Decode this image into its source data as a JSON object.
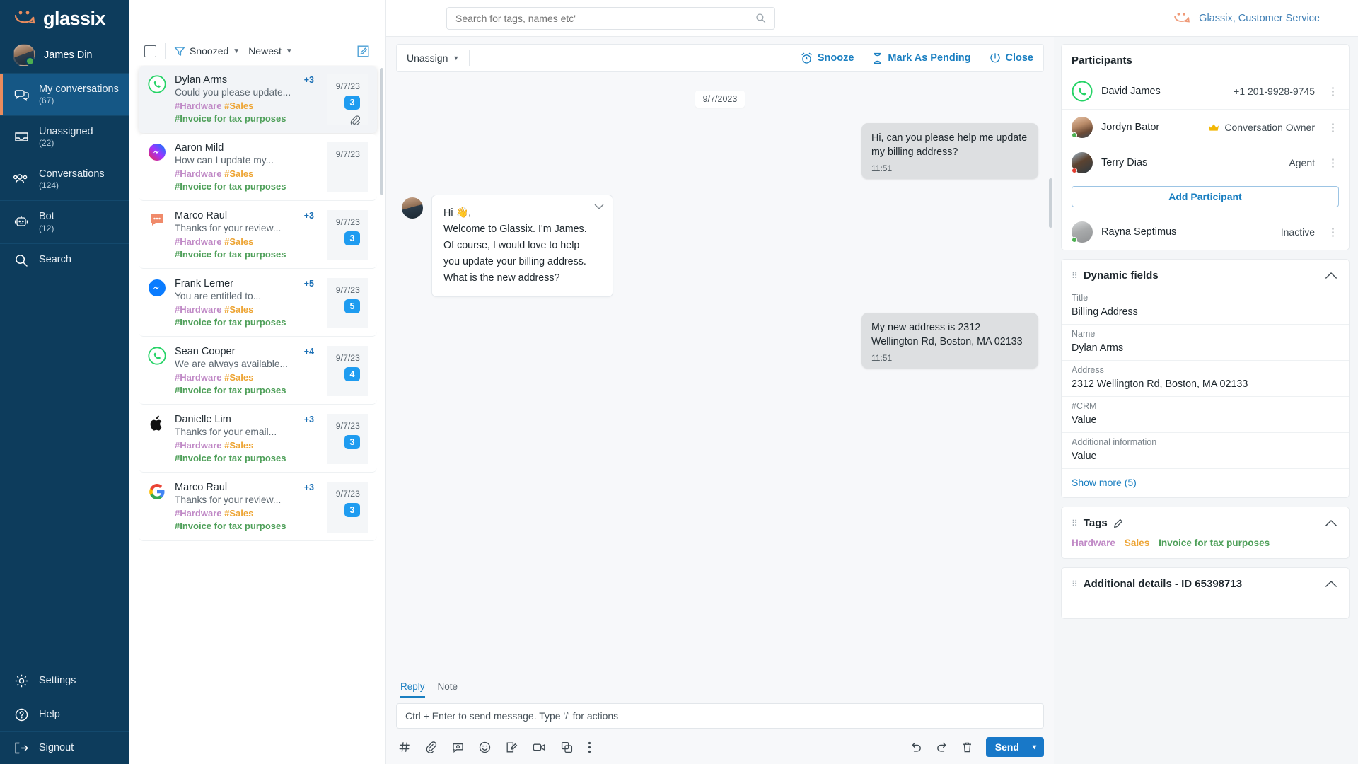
{
  "brand": {
    "name": "glassix",
    "accent": "#e98c5e",
    "nav_bg": "#0d3c5c",
    "active_bg": "#155785",
    "link_blue": "#1a7fc1"
  },
  "topbar": {
    "search_placeholder": "Search for tags, names etc'",
    "account_label": "Glassix, Customer Service"
  },
  "nav": {
    "user_name": "James Din",
    "items": [
      {
        "label": "My conversations",
        "count": "(67)",
        "icon": "conversations-icon",
        "active": true
      },
      {
        "label": "Unassigned",
        "count": "(22)",
        "icon": "inbox-icon",
        "active": false
      },
      {
        "label": "Conversations",
        "count": "(124)",
        "icon": "people-icon",
        "active": false
      },
      {
        "label": "Bot",
        "count": "(12)",
        "icon": "robot-icon",
        "active": false
      },
      {
        "label": "Search",
        "count": "",
        "icon": "search-icon",
        "active": false
      }
    ],
    "bottom_items": [
      {
        "label": "Settings",
        "icon": "gear-icon"
      },
      {
        "label": "Help",
        "icon": "question-circle-icon"
      },
      {
        "label": "Signout",
        "icon": "signout-icon"
      }
    ]
  },
  "list_toolbar": {
    "filter_label": "Snoozed",
    "sort_label": "Newest",
    "filter_icon": "funnel-icon",
    "compose_icon": "compose-icon",
    "select_all_icon": "checkbox-icon"
  },
  "conversations": [
    {
      "name": "Dylan Arms",
      "snippet": "Could you please update...",
      "plus": "+3",
      "date": "9/7/23",
      "badge": "3",
      "channel": "whatsapp-icon",
      "selected": true,
      "attachment": true,
      "tags": [
        "#Hardware",
        "#Sales",
        "#Invoice for tax purposes"
      ]
    },
    {
      "name": "Aaron Mild",
      "snippet": "How can I update my...",
      "plus": "",
      "date": "9/7/23",
      "badge": "",
      "channel": "messenger-icon",
      "selected": false,
      "attachment": false,
      "tags": [
        "#Hardware",
        "#Sales",
        "#Invoice for tax purposes"
      ]
    },
    {
      "name": "Marco Raul",
      "snippet": "Thanks for your review...",
      "plus": "+3",
      "date": "9/7/23",
      "badge": "3",
      "channel": "sms-icon",
      "selected": false,
      "attachment": false,
      "tags": [
        "#Hardware",
        "#Sales",
        "#Invoice for tax purposes"
      ]
    },
    {
      "name": "Frank Lerner",
      "snippet": "You are entitled to...",
      "plus": "+5",
      "date": "9/7/23",
      "badge": "5",
      "channel": "messenger-icon",
      "selected": false,
      "attachment": false,
      "tags": [
        "#Hardware",
        "#Sales",
        "#Invoice for tax purposes"
      ]
    },
    {
      "name": "Sean Cooper",
      "snippet": "We are always available...",
      "plus": "+4",
      "date": "9/7/23",
      "badge": "4",
      "channel": "whatsapp-icon",
      "selected": false,
      "attachment": false,
      "tags": [
        "#Hardware",
        "#Sales",
        "#Invoice for tax purposes"
      ]
    },
    {
      "name": "Danielle Lim",
      "snippet": "Thanks for your email...",
      "plus": "+3",
      "date": "9/7/23",
      "badge": "3",
      "channel": "apple-icon",
      "selected": false,
      "attachment": false,
      "tags": [
        "#Hardware",
        "#Sales",
        "#Invoice for tax purposes"
      ]
    },
    {
      "name": "Marco Raul",
      "snippet": "Thanks for your review...",
      "plus": "+3",
      "date": "9/7/23",
      "badge": "3",
      "channel": "google-icon",
      "selected": false,
      "attachment": false,
      "tags": [
        "#Hardware",
        "#Sales",
        "#Invoice for tax purposes"
      ]
    }
  ],
  "chat_header": {
    "assign_label": "Unassign",
    "actions": [
      {
        "label": "Snooze",
        "icon": "alarm-icon"
      },
      {
        "label": "Mark As Pending",
        "icon": "hourglass-icon"
      },
      {
        "label": "Close",
        "icon": "power-icon"
      }
    ]
  },
  "chat": {
    "date_divider": "9/7/2023",
    "messages": [
      {
        "direction": "out",
        "text": "Hi, can you please help me update my billing address?",
        "time": "11:51"
      },
      {
        "direction": "in",
        "text": "Hi 👋,\nWelcome to Glassix. I'm James.\nOf course, I would love to help\nyou update your billing address.\nWhat is the new address?",
        "time": ""
      },
      {
        "direction": "out",
        "text": "My new address is 2312 Wellington Rd, Boston, MA 02133",
        "time": "11:51"
      }
    ]
  },
  "composer": {
    "tabs": [
      {
        "label": "Reply",
        "active": true
      },
      {
        "label": "Note",
        "active": false
      }
    ],
    "placeholder": "Ctrl + Enter to send message. Type '/' for actions",
    "tools": [
      "hashtag-icon",
      "paperclip-icon",
      "canned-response-icon",
      "emoji-icon",
      "signature-icon",
      "video-icon",
      "template-icon",
      "more-icon"
    ],
    "right_tools": [
      "undo-icon",
      "redo-icon",
      "trash-icon"
    ],
    "send_label": "Send",
    "send_caret": "▾"
  },
  "participants": {
    "title": "Participants",
    "add_label": "Add Participant",
    "rows": [
      {
        "name": "David James",
        "meta": "+1 201-9928-9745",
        "crown": false,
        "channel": "whatsapp-icon",
        "status": "none"
      },
      {
        "name": "Jordyn Bator",
        "meta": "Conversation Owner",
        "crown": true,
        "channel": "",
        "status": "online"
      },
      {
        "name": "Terry Dias",
        "meta": "Agent",
        "crown": false,
        "channel": "",
        "status": "busy"
      },
      {
        "name": "Rayna Septimus",
        "meta": "Inactive",
        "crown": false,
        "channel": "",
        "status": "online"
      }
    ]
  },
  "dynamic_fields": {
    "title": "Dynamic fields",
    "show_more": "Show more (5)",
    "fields": [
      {
        "label": "Title",
        "value": "Billing Address"
      },
      {
        "label": "Name",
        "value": "Dylan Arms"
      },
      {
        "label": "Address",
        "value": "2312 Wellington Rd, Boston, MA 02133"
      },
      {
        "label": "#CRM",
        "value": "Value"
      },
      {
        "label": "Additional information",
        "value": "Value"
      }
    ]
  },
  "tags_card": {
    "title": "Tags",
    "edit_icon": "pencil-icon",
    "tags": [
      "Hardware",
      "Sales",
      "Invoice for tax purposes"
    ]
  },
  "additional_details": {
    "title": "Additional details -  ID 65398713"
  }
}
